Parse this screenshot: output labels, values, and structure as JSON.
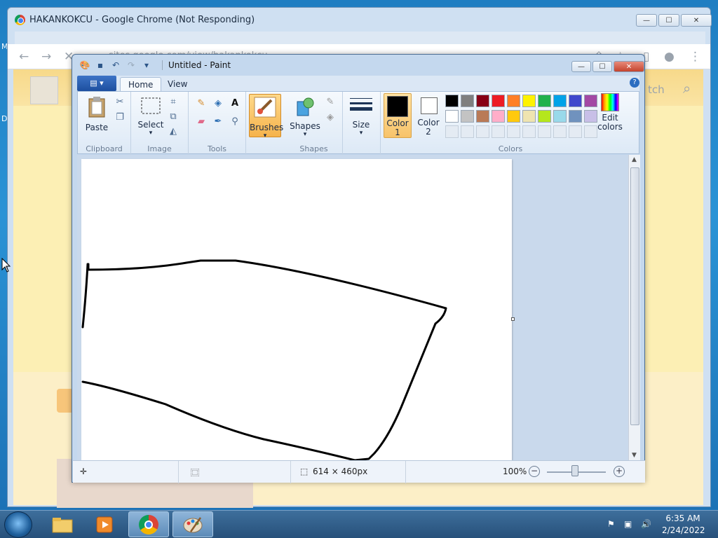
{
  "desktop": {
    "edge_text_1": "M",
    "edge_text_2": "D"
  },
  "chrome": {
    "title": "HAKANKOKCU - Google Chrome (Not Responding)",
    "url": "sites.google.com/view/hakankokcu",
    "site_search_label": "tch"
  },
  "window_controls": {
    "minimize": "—",
    "maximize": "☐",
    "close": "✕"
  },
  "paint": {
    "title": "Untitled - Paint",
    "tabs": [
      {
        "label": "Home"
      },
      {
        "label": "View"
      }
    ],
    "groups": {
      "clipboard": {
        "label": "Clipboard",
        "paste": "Paste"
      },
      "image": {
        "label": "Image",
        "select": "Select"
      },
      "tools": {
        "label": "Tools"
      },
      "brushes": {
        "label": "Brushes"
      },
      "shapes": {
        "label": "Shapes",
        "shapes_btn": "Shapes"
      },
      "size": {
        "label": "Size"
      },
      "colors": {
        "label": "Colors",
        "color1": "Color\n1",
        "color2": "Color\n2",
        "edit": "Edit\ncolors",
        "color1_value": "#000000",
        "color2_value": "#ffffff",
        "palette_row1": [
          "#000000",
          "#7f7f7f",
          "#880015",
          "#ed1c24",
          "#ff7f27",
          "#fff200",
          "#22b14c",
          "#00a2e8",
          "#3f48cc",
          "#a349a4"
        ],
        "palette_row2": [
          "#ffffff",
          "#c3c3c3",
          "#b97a57",
          "#ffaec9",
          "#ffc90e",
          "#efe4b0",
          "#b5e61d",
          "#99d9ea",
          "#7092be",
          "#c8bfe7"
        ]
      }
    },
    "status": {
      "dimensions": "614 × 460px",
      "zoom": "100%"
    }
  },
  "taskbar": {
    "time": "6:35 AM",
    "date": "2/24/2022"
  }
}
